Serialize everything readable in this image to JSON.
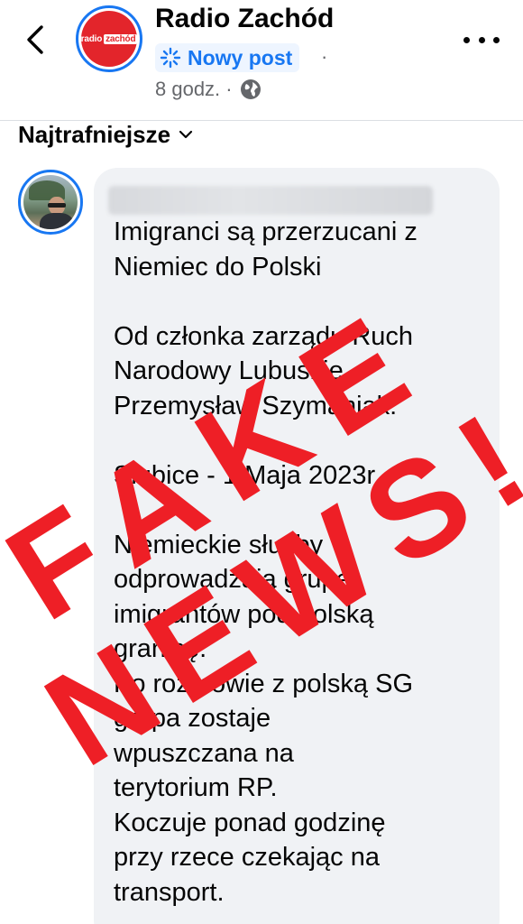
{
  "header": {
    "page_name": "Radio Zachód",
    "logo": {
      "left": "radio",
      "right": "zachód",
      "brand_color": "#e3252b"
    },
    "badge_label": "Nowy post",
    "separator": "·",
    "time": "8 godz. ·",
    "icons": [
      "back-arrow-icon",
      "sparkle-icon",
      "globe-icon",
      "more-icon"
    ]
  },
  "sort": {
    "label": "Najtrafniejsze",
    "icon": "chevron-down-icon"
  },
  "comment": {
    "author_hidden": true,
    "text": "Imigranci są przerzucani z\nNiemiec do Polski\n\nOd członka zarządu Ruch\nNarodowy Lubuskie\nPrzemysław Szymaniak:\n\nSłubice  - 1 Maja 2023r.\n\nNiemieckie służby\nodprowadzają grupę\nimigrantów pod polską\ngranicę.\nPo rozmowie z polską SG\ngrupa zostaje\nwpuszczana na\nterytorium RP.\nKoczuje ponad godzinę\nprzy rzece czekając na\ntransport."
  },
  "stamp": {
    "line1": "FAKE",
    "line2": "NEWS!",
    "color": "#ee1f26"
  },
  "colors": {
    "accent": "#1877f2",
    "bubble": "#f0f2f5",
    "muted": "#65676b"
  }
}
